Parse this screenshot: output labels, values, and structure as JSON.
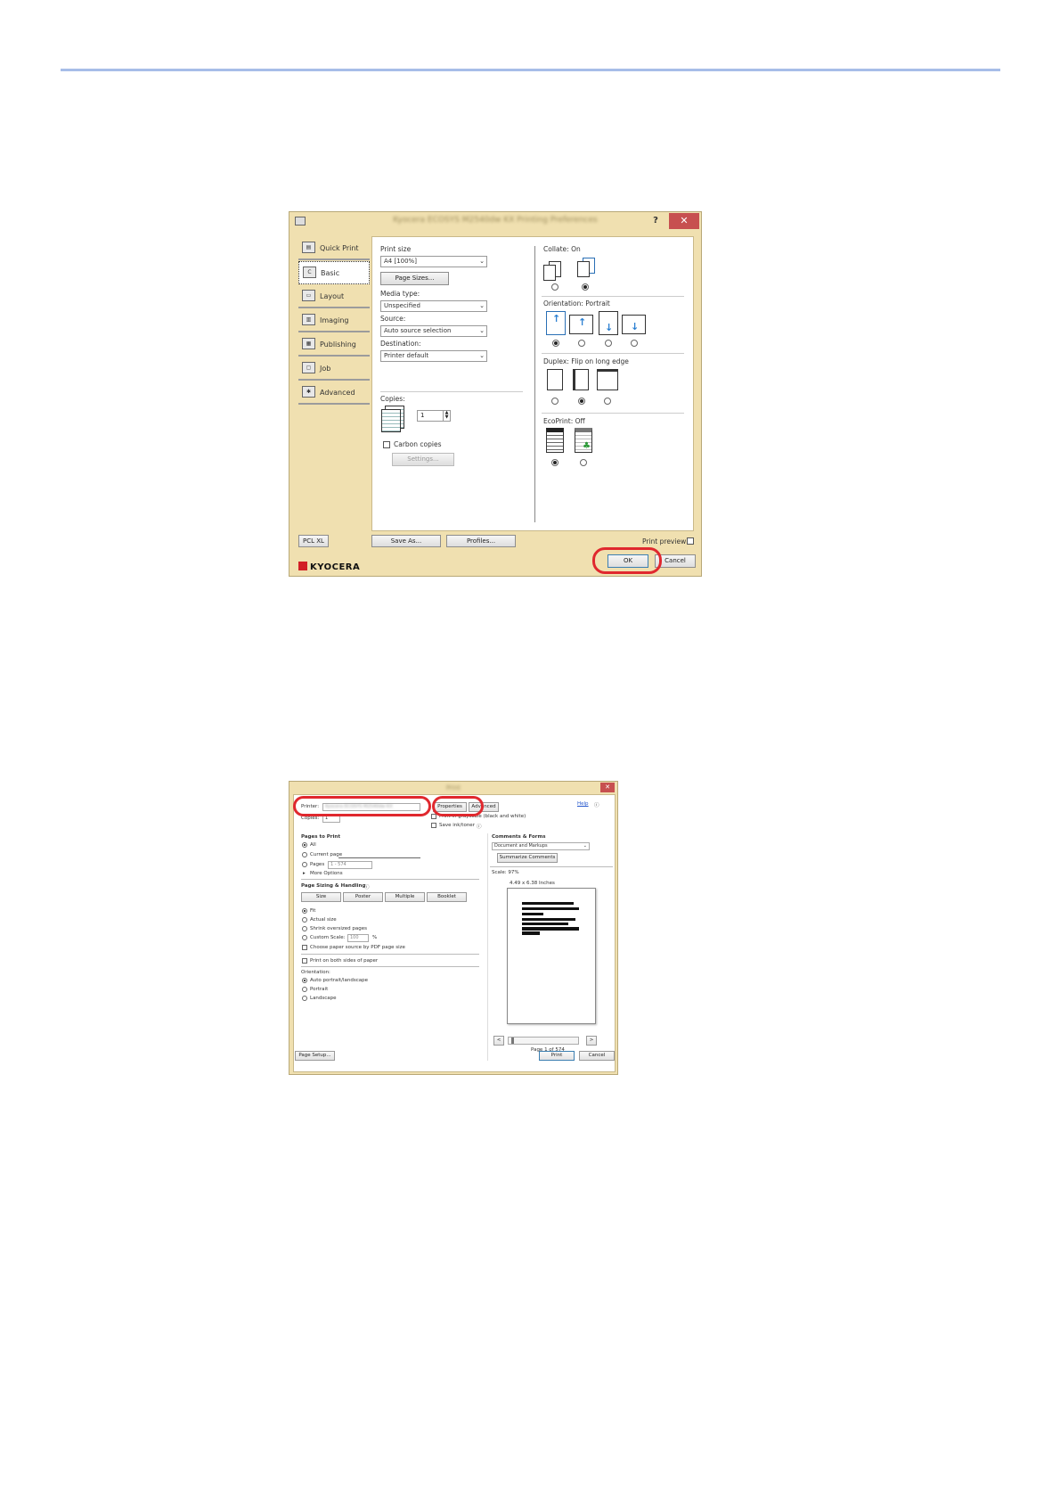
{
  "colors": {
    "accent_rule": "#a7bde8",
    "callout": "#e0282e",
    "dialog_frame": "#f0e0b0",
    "close_button": "#c75050"
  },
  "dialog1": {
    "title": "Kyocera ECOSYS M2540dw KX Printing Preferences",
    "help_label": "?",
    "close_label": "✕",
    "sidebar": [
      {
        "label": "Quick Print",
        "icon": "quick-print-icon"
      },
      {
        "label": "Basic",
        "icon": "basic-icon"
      },
      {
        "label": "Layout",
        "icon": "layout-icon"
      },
      {
        "label": "Imaging",
        "icon": "imaging-icon"
      },
      {
        "label": "Publishing",
        "icon": "publishing-icon"
      },
      {
        "label": "Job",
        "icon": "job-icon"
      },
      {
        "label": "Advanced",
        "icon": "advanced-icon"
      }
    ],
    "print_size_label": "Print size",
    "print_size_value": "A4 [100%]",
    "page_sizes_button": "Page Sizes...",
    "media_type_label": "Media type:",
    "media_type_value": "Unspecified",
    "source_label": "Source:",
    "source_value": "Auto source selection",
    "destination_label": "Destination:",
    "destination_value": "Printer default",
    "copies_label": "Copies:",
    "copies_value": "1",
    "carbon_copies_label": "Carbon copies",
    "settings_button": "Settings...",
    "collate_label": "Collate:",
    "collate_value": "On",
    "orientation_label": "Orientation:",
    "orientation_value": "Portrait",
    "duplex_label": "Duplex:",
    "duplex_value": "Flip on long edge",
    "ecoprint_label": "EcoPrint:",
    "ecoprint_value": "Off",
    "pcl_button": "PCL XL",
    "save_as_button": "Save As...",
    "profiles_button": "Profiles...",
    "print_preview_label": "Print preview",
    "ok_button": "OK",
    "cancel_button": "Cancel",
    "logo_text": "KYOCERA"
  },
  "dialog2": {
    "title": "Print",
    "close_label": "✕",
    "printer_label": "Printer:",
    "printer_value": "Kyocera ECOSYS M2540dw KX",
    "properties_button": "Properties",
    "advanced_button": "Advanced",
    "help_link": "Help",
    "copies_label": "Copies:",
    "copies_value": "1",
    "grayscale_label": "Print in grayscale (black and white)",
    "save_ink_label": "Save ink/toner",
    "pages_to_print_label": "Pages to Print",
    "opt_all": "All",
    "opt_current_page": "Current page",
    "opt_pages": "Pages",
    "pages_value": "1 - 574",
    "more_options": "More Options",
    "page_sizing_label": "Page Sizing & Handling",
    "tab_size": "Size",
    "tab_poster": "Poster",
    "tab_multiple": "Multiple",
    "tab_booklet": "Booklet",
    "opt_fit": "Fit",
    "opt_actual_size": "Actual size",
    "opt_shrink": "Shrink oversized pages",
    "opt_custom_scale": "Custom Scale:",
    "custom_scale_value": "100",
    "percent_sign": "%",
    "choose_paper_source": "Choose paper source by PDF page size",
    "print_both_sides": "Print on both sides of paper",
    "orientation_label": "Orientation:",
    "opt_auto_orientation": "Auto portrait/landscape",
    "opt_portrait": "Portrait",
    "opt_landscape": "Landscape",
    "comments_forms_label": "Comments & Forms",
    "comments_value": "Document and Markups",
    "summarize_button": "Summarize Comments",
    "scale_label": "Scale: 97%",
    "page_dims": "4.49 x 6.38 Inches",
    "page_count": "Page 1 of 574",
    "prev_button": "<",
    "next_button": ">",
    "page_setup_button": "Page Setup...",
    "print_button": "Print",
    "cancel_button": "Cancel"
  }
}
